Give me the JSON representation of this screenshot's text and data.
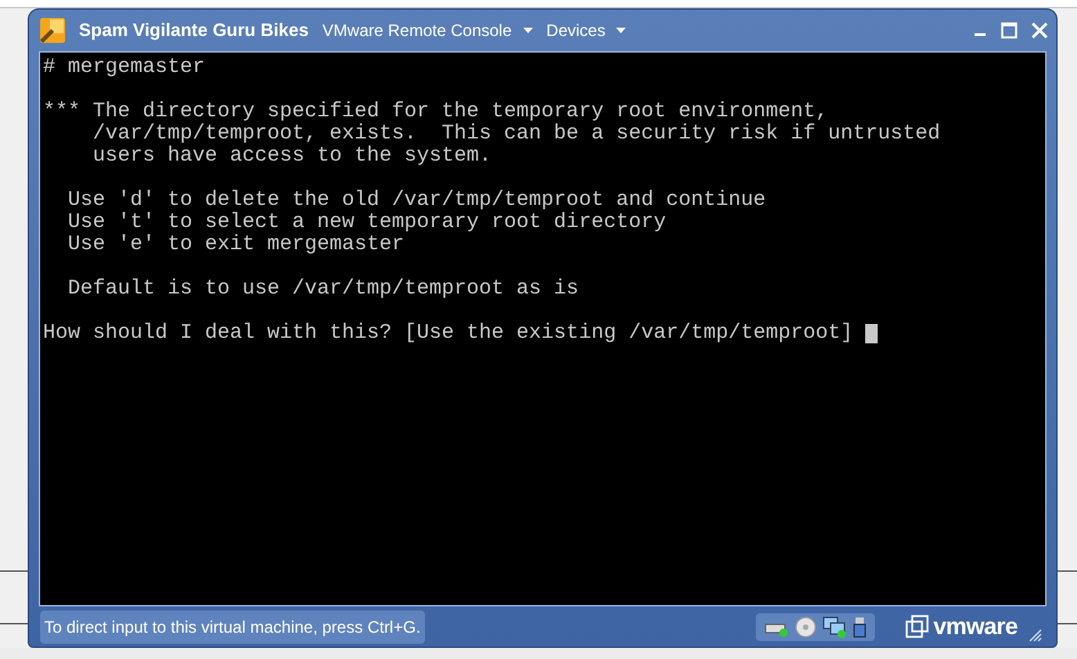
{
  "window": {
    "title": "Spam Vigilante Guru Bikes"
  },
  "menus": [
    {
      "label": "VMware Remote Console"
    },
    {
      "label": "Devices"
    }
  ],
  "console": {
    "blocks": [
      [
        "# mergemaster"
      ],
      [
        "*** The directory specified for the temporary root environment,",
        "    /var/tmp/temproot, exists.  This can be a security risk if untrusted",
        "    users have access to the system."
      ],
      [
        "  Use 'd' to delete the old /var/tmp/temproot and continue",
        "  Use 't' to select a new temporary root directory",
        "  Use 'e' to exit mergemaster"
      ],
      [
        "  Default is to use /var/tmp/temproot as is"
      ],
      [
        "How should I deal with this? [Use the existing /var/tmp/temproot] "
      ]
    ],
    "cursor": true
  },
  "status_bar": {
    "hint": "To direct input to this virtual machine, press Ctrl+G.",
    "brand": "vmware"
  }
}
